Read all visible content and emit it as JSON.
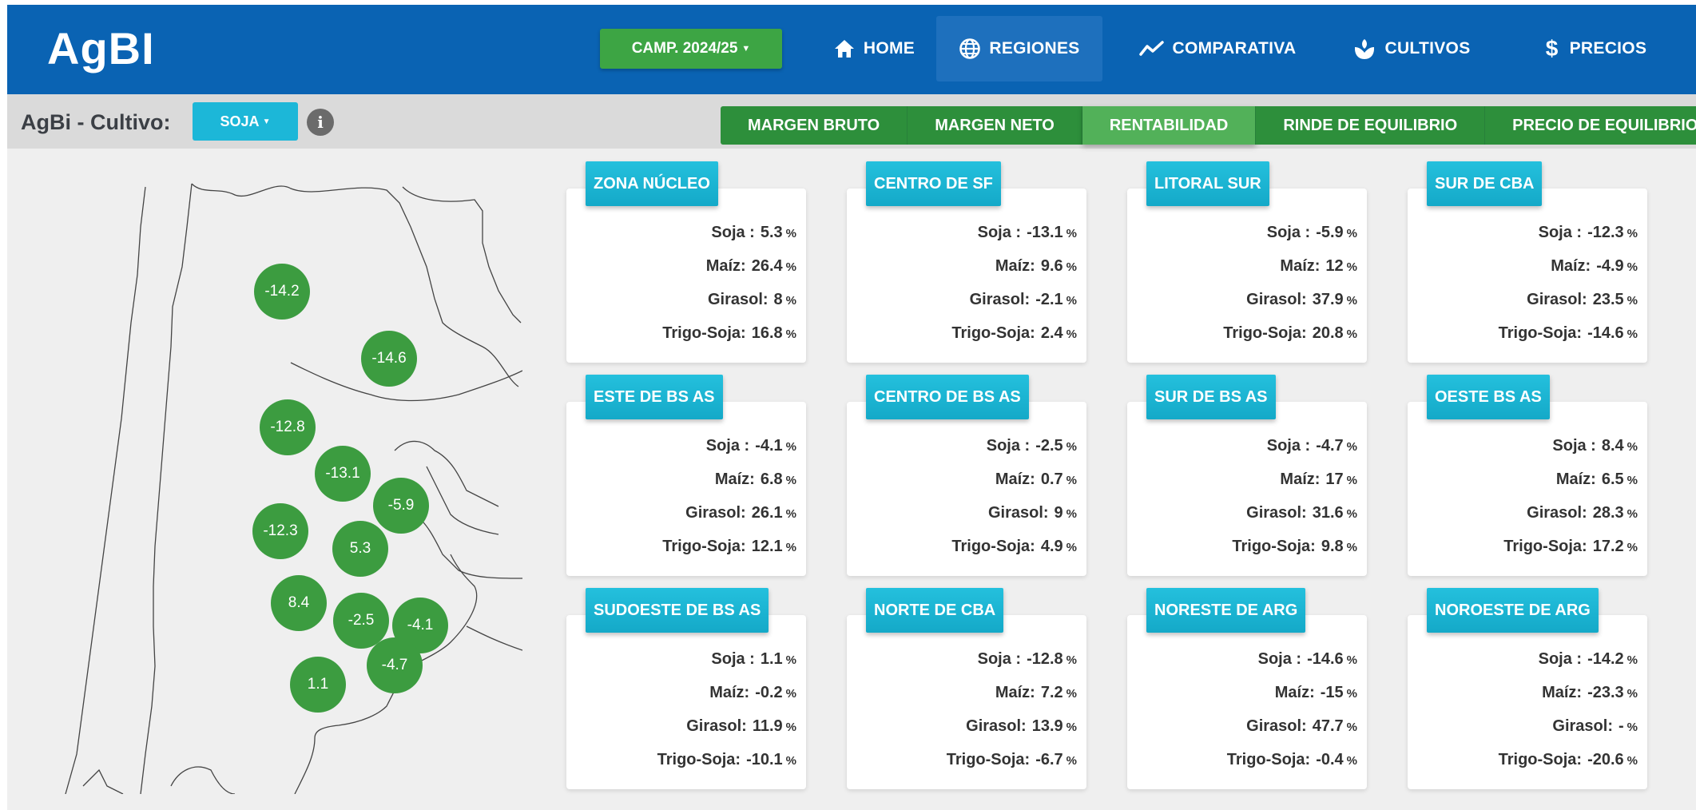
{
  "brand": "AgBI",
  "campaign": {
    "label": "CAMP. 2024/25"
  },
  "nav": {
    "home": "HOME",
    "regiones": "REGIONES",
    "comparativa": "COMPARATIVA",
    "cultivos": "CULTIVOS",
    "precios": "PRECIOS"
  },
  "subbar": {
    "crop_label": "AgBi - Cultivo:",
    "crop_value": "SOJA",
    "tabs": [
      "MARGEN BRUTO",
      "MARGEN NETO",
      "RENTABILIDAD",
      "RINDE DE EQUILIBRIO",
      "PRECIO DE EQUILIBRIO"
    ],
    "active_tab": "RENTABILIDAD"
  },
  "map": {
    "bubbles": [
      "-14.2",
      "-14.6",
      "-12.8",
      "-13.1",
      "-5.9",
      "-12.3",
      "5.3",
      "8.4",
      "-2.5",
      "-4.1",
      "-4.7",
      "1.1"
    ]
  },
  "unit": "%",
  "row_labels": [
    "Soja :",
    "Maíz:",
    "Girasol:",
    "Trigo-Soja:"
  ],
  "regions": [
    {
      "name": "ZONA NÚCLEO",
      "values": [
        "5.3",
        "26.4",
        "8",
        "16.8"
      ]
    },
    {
      "name": "CENTRO DE SF",
      "values": [
        "-13.1",
        "9.6",
        "-2.1",
        "2.4"
      ]
    },
    {
      "name": "LITORAL SUR",
      "values": [
        "-5.9",
        "12",
        "37.9",
        "20.8"
      ]
    },
    {
      "name": "SUR DE CBA",
      "values": [
        "-12.3",
        "-4.9",
        "23.5",
        "-14.6"
      ]
    },
    {
      "name": "ESTE DE BS AS",
      "values": [
        "-4.1",
        "6.8",
        "26.1",
        "12.1"
      ]
    },
    {
      "name": "CENTRO DE BS AS",
      "values": [
        "-2.5",
        "0.7",
        "9",
        "4.9"
      ]
    },
    {
      "name": "SUR DE BS AS",
      "values": [
        "-4.7",
        "17",
        "31.6",
        "9.8"
      ]
    },
    {
      "name": "OESTE BS AS",
      "values": [
        "8.4",
        "6.5",
        "28.3",
        "17.2"
      ]
    },
    {
      "name": "SUDOESTE DE BS AS",
      "values": [
        "1.1",
        "-0.2",
        "11.9",
        "-10.1"
      ]
    },
    {
      "name": "NORTE DE CBA",
      "values": [
        "-12.8",
        "7.2",
        "13.9",
        "-6.7"
      ]
    },
    {
      "name": "NORESTE DE ARG",
      "values": [
        "-14.6",
        "-15",
        "47.7",
        "-0.4"
      ]
    },
    {
      "name": "NOROESTE DE ARG",
      "values": [
        "-14.2",
        "-23.3",
        "-",
        "-20.6"
      ]
    }
  ],
  "colors": {
    "nav": "#0a63b3",
    "green": "#3da544",
    "cyan": "#1cb7d8",
    "bubble": "#3c9c40"
  }
}
